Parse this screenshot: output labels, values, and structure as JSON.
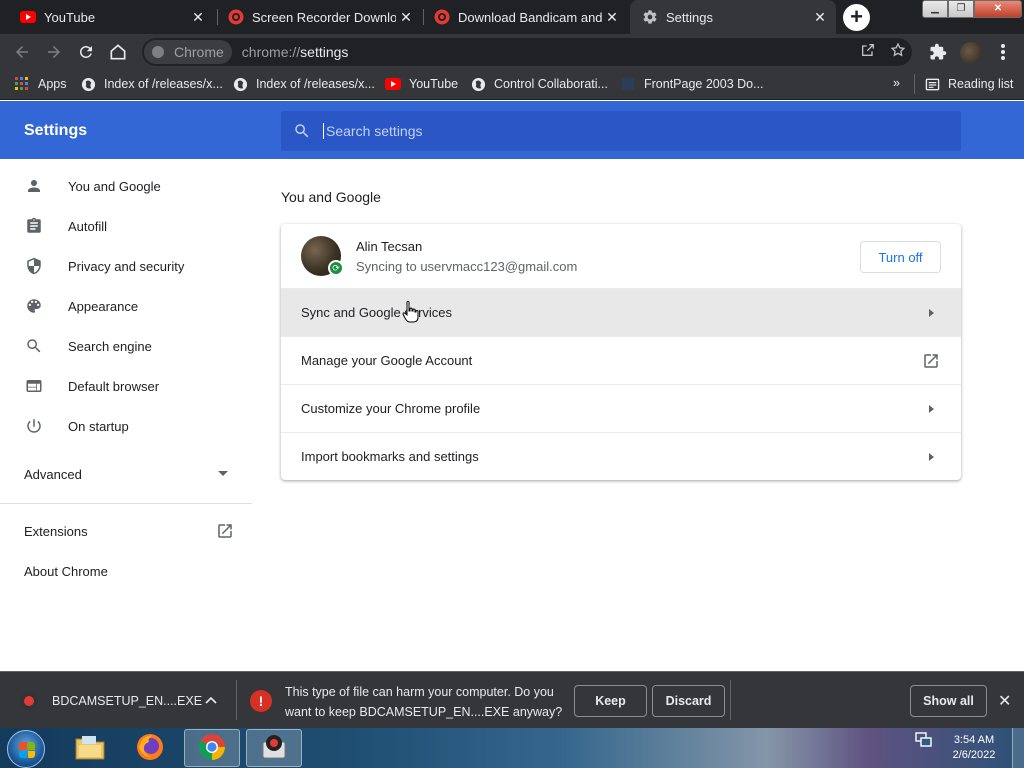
{
  "tabs": [
    {
      "title": "YouTube",
      "icon": "youtube-icon",
      "active": false
    },
    {
      "title": "Screen Recorder Download",
      "icon": "bandicam-icon",
      "active": false
    },
    {
      "title": "Download Bandicam and E",
      "icon": "bandicam-icon",
      "active": false
    },
    {
      "title": "Settings",
      "icon": "gear-icon",
      "active": true
    }
  ],
  "omnibox": {
    "chip_label": "Chrome",
    "url_scheme": "chrome://",
    "url_host": "settings"
  },
  "bookmarks": [
    {
      "label": "Apps",
      "icon": "apps-grid-icon"
    },
    {
      "label": "Index of /releases/x...",
      "icon": "globe-icon"
    },
    {
      "label": "Index of /releases/x...",
      "icon": "globe-icon"
    },
    {
      "label": "YouTube",
      "icon": "youtube-icon"
    },
    {
      "label": "Control Collaborati...",
      "icon": "globe-icon"
    },
    {
      "label": "FrontPage 2003 Do...",
      "icon": "document-icon"
    }
  ],
  "reading_list": "Reading list",
  "settings": {
    "title": "Settings",
    "search_placeholder": "Search settings"
  },
  "sidebar": {
    "items": [
      {
        "label": "You and Google",
        "icon": "person-icon"
      },
      {
        "label": "Autofill",
        "icon": "clipboard-icon"
      },
      {
        "label": "Privacy and security",
        "icon": "shield-icon"
      },
      {
        "label": "Appearance",
        "icon": "palette-icon"
      },
      {
        "label": "Search engine",
        "icon": "search-icon"
      },
      {
        "label": "Default browser",
        "icon": "browser-window-icon"
      },
      {
        "label": "On startup",
        "icon": "power-icon"
      }
    ],
    "advanced": "Advanced",
    "extensions": "Extensions",
    "about": "About Chrome"
  },
  "main": {
    "section_title": "You and Google",
    "profile": {
      "name": "Alin Tecsan",
      "sync_status": "Syncing to uservmacc123@gmail.com",
      "turn_off": "Turn off"
    },
    "rows": [
      {
        "label": "Sync and Google services",
        "trailing": "arrow-right-icon"
      },
      {
        "label": "Manage your Google Account",
        "trailing": "external-link-icon"
      },
      {
        "label": "Customize your Chrome profile",
        "trailing": "arrow-right-icon"
      },
      {
        "label": "Import bookmarks and settings",
        "trailing": "arrow-right-icon"
      }
    ]
  },
  "download_bar": {
    "file_name": "BDCAMSETUP_EN....EXE",
    "warning": "This type of file can harm your computer. Do you want to keep BDCAMSETUP_EN....EXE anyway?",
    "keep": "Keep",
    "discard": "Discard",
    "show_all": "Show all"
  },
  "taskbar": {
    "time": "3:54 AM",
    "date": "2/6/2022"
  },
  "colors": {
    "header_blue": "#3367d6",
    "link_blue": "#1a73e8",
    "dark_chrome": "#35363a"
  }
}
